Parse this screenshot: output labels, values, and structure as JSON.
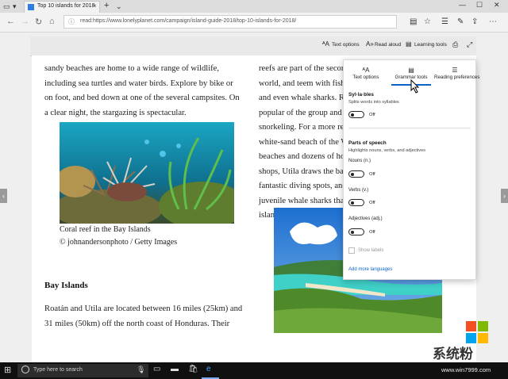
{
  "browser": {
    "tab_title": "Top 10 islands for 2018",
    "address": "read:https://www.lonelyplanet.com/campaign/island-guide-2018/top-10-islands-for-2018/"
  },
  "reader_toolbar": {
    "text_options": "Text options",
    "read_aloud": "Read aloud",
    "learning_tools": "Learning tools"
  },
  "article": {
    "left_paragraph": [
      "sandy beaches are home to a wide range of wildlife,",
      "including sea turtles and water birds. Explore by bike or",
      "on foot, and bed down at one of the several campsites. On",
      "a clear night, the stargazing is spectacular."
    ],
    "caption": [
      "Coral reef in the Bay Islands",
      "© johnandersonphoto / Getty Images"
    ],
    "heading": "Bay Islands",
    "left_paragraph_2": [
      "Roatán and Utila are located between 16 miles (25km) and",
      "31 miles (50km) off the north coast of Honduras. Their"
    ],
    "right_paragraph": [
      "reefs are part of the secon",
      "world, and teem with fish",
      "and even whale sharks. Ro",
      "popular of the group and i",
      "snorkeling. For a more rel",
      "white-sand beach of the W",
      "beaches and dozens of hot",
      "shops, Utila draws the bac",
      "fantastic diving spots, and",
      "juvenile whale sharks that",
      "island."
    ]
  },
  "panel": {
    "tabs": [
      "Text options",
      "Grammar tools",
      "Reading preferences"
    ],
    "syllables_title": "Syl·la·bles",
    "syllables_desc": "Splits words into syllables",
    "off": "Off",
    "pos_title": "Parts of speech",
    "pos_desc": "Highlights nouns, verbs, and adjectives",
    "nouns": "Nouns (n.)",
    "verbs": "Verbs (v.)",
    "adjectives": "Adjectives (adj.)",
    "show_labels": "Show labels",
    "add_languages": "Add more languages"
  },
  "taskbar": {
    "search_placeholder": "Type here to search"
  },
  "watermark": {
    "text": "系统粉",
    "url": "www.win7999.com"
  },
  "colors": {
    "accent": "#0a64c8",
    "taskbar": "#101010"
  }
}
